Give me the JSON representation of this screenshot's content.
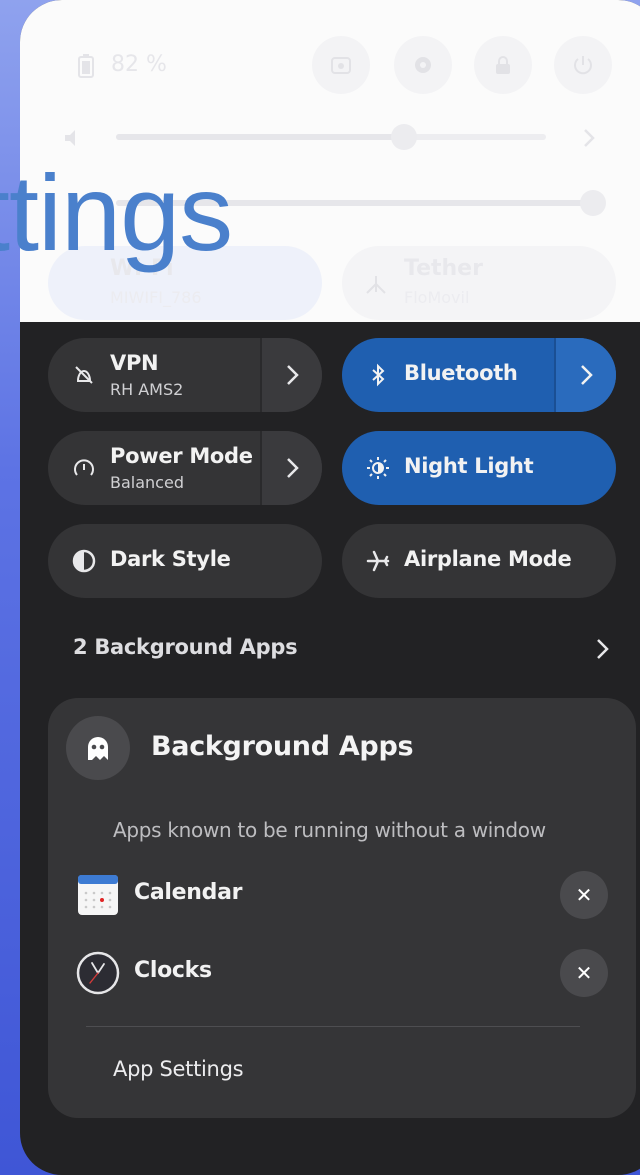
{
  "overlay": {
    "title_fragment": "ttings"
  },
  "top_bar": {
    "battery_icon": "battery-icon",
    "battery_percent": "82 %",
    "buttons": [
      "screenshot-icon",
      "gear-icon",
      "lock-icon",
      "power-icon"
    ]
  },
  "sliders": {
    "volume": {
      "icon": "speaker-icon",
      "level": 0.68
    },
    "brightness": {
      "icon": "sun-icon",
      "level": 1.0
    }
  },
  "faded_tiles": [
    {
      "title": "Wi-Fi",
      "subtitle": "MIWIFI_786",
      "active": true
    },
    {
      "title": "Tether",
      "subtitle": "FloMovil",
      "active": false
    }
  ],
  "tiles": [
    {
      "id": "vpn",
      "title": "VPN",
      "subtitle": "RH AMS2",
      "icon": "vpn-off-icon",
      "active": false,
      "has_menu": true
    },
    {
      "id": "bluetooth",
      "title": "Bluetooth",
      "subtitle": "",
      "icon": "bluetooth-icon",
      "active": true,
      "has_menu": true
    },
    {
      "id": "power-mode",
      "title": "Power Mode",
      "subtitle": "Balanced",
      "icon": "power-mode-icon",
      "active": false,
      "has_menu": true
    },
    {
      "id": "night-light",
      "title": "Night Light",
      "subtitle": "",
      "icon": "night-light-icon",
      "active": true,
      "has_menu": false
    },
    {
      "id": "dark-style",
      "title": "Dark Style",
      "subtitle": "",
      "icon": "dark-style-icon",
      "active": false,
      "has_menu": false
    },
    {
      "id": "airplane-mode",
      "title": "Airplane Mode",
      "subtitle": "",
      "icon": "airplane-icon",
      "active": false,
      "has_menu": false
    }
  ],
  "background_apps_row": {
    "label": "2 Background Apps"
  },
  "background_apps_menu": {
    "title": "Background Apps",
    "subtitle": "Apps known to be running without a window",
    "apps": [
      {
        "name": "Calendar",
        "icon": "calendar-icon"
      },
      {
        "name": "Clocks",
        "icon": "clock-icon"
      }
    ],
    "footer": "App Settings"
  },
  "colors": {
    "panel": "#222224",
    "tile": "#343436",
    "accent": "#1f5fb0",
    "card": "#353537",
    "overlay_text": "#4a80cc"
  }
}
